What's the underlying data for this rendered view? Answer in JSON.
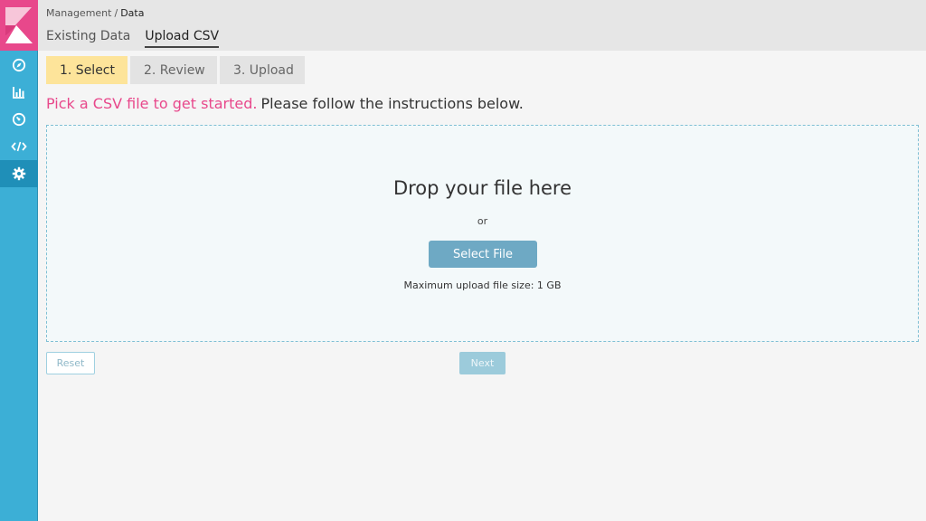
{
  "breadcrumb": {
    "parent": "Management",
    "separator": "/",
    "current": "Data"
  },
  "tabs": [
    {
      "label": "Existing Data",
      "active": false
    },
    {
      "label": "Upload CSV",
      "active": true
    }
  ],
  "steps": [
    {
      "label": "1. Select",
      "active": true
    },
    {
      "label": "2. Review",
      "active": false
    },
    {
      "label": "3. Upload",
      "active": false
    }
  ],
  "headline": {
    "highlight": "Pick a CSV file to get started.",
    "rest": "Please follow the instructions below."
  },
  "dropzone": {
    "title": "Drop your file here",
    "or": "or",
    "select_button": "Select File",
    "max_size": "Maximum upload file size: 1 GB"
  },
  "actions": {
    "reset_label": "Reset",
    "next_label": "Next"
  },
  "sidebar": {
    "items": [
      {
        "icon": "compass-icon",
        "active": false
      },
      {
        "icon": "bar-chart-icon",
        "active": false
      },
      {
        "icon": "dashboard-gauge-icon",
        "active": false
      },
      {
        "icon": "code-icon",
        "active": false
      },
      {
        "icon": "gear-icon",
        "active": true
      }
    ]
  },
  "colors": {
    "sidebar": "#3cafd6",
    "sidebar_active": "#1f8fb8",
    "logo": "#e8488b",
    "accent_pink": "#e8488b",
    "active_step": "#fde49a",
    "select_button": "#6ea9c4"
  }
}
